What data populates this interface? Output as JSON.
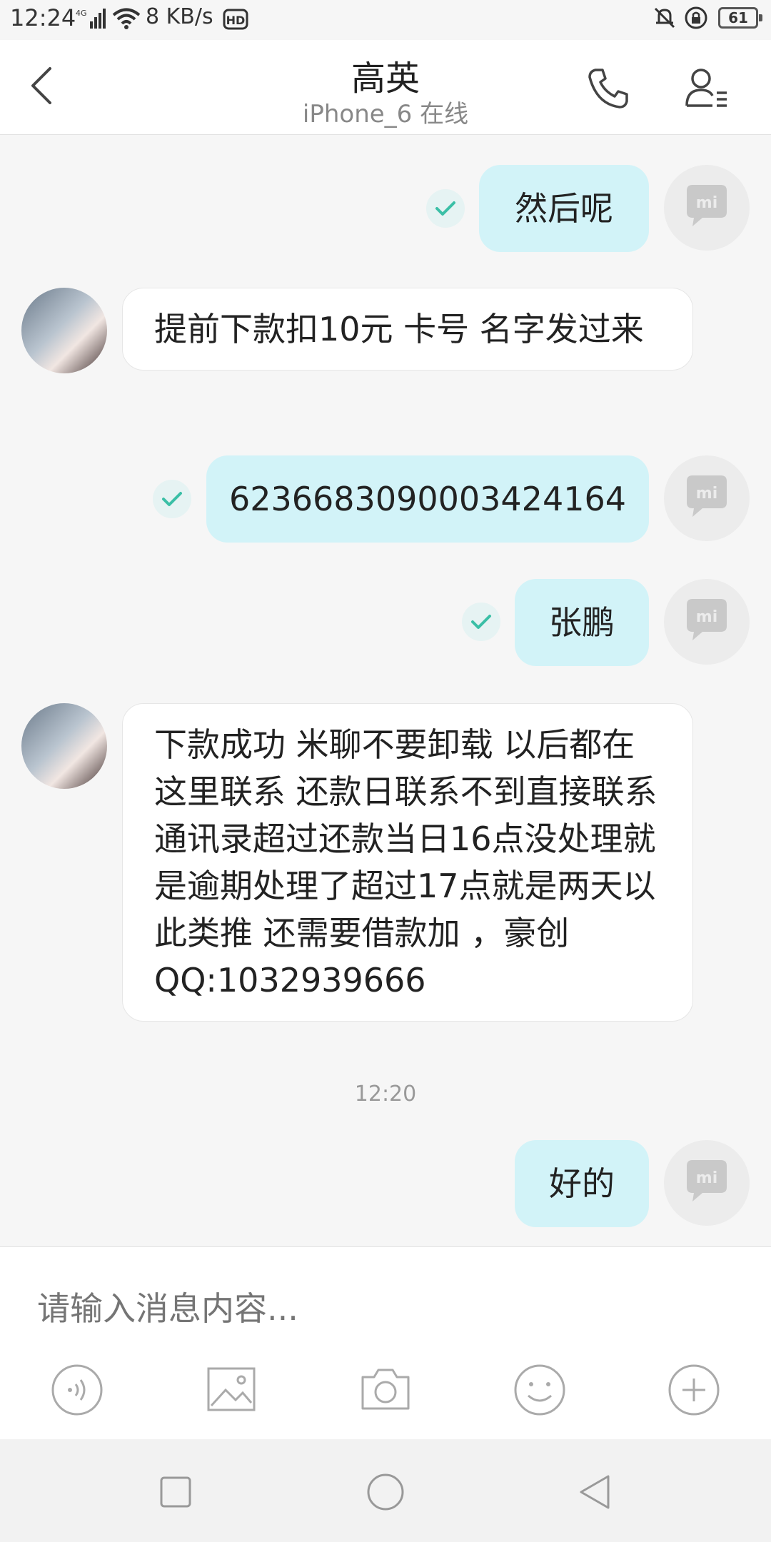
{
  "status_bar": {
    "time": "12:24",
    "network": "4G",
    "speed": "8 KB/s",
    "hd": "HD",
    "battery": "61",
    "icons": [
      "signal-icon",
      "wifi-icon",
      "hd-icon",
      "mute-icon",
      "lock-icon",
      "battery-icon"
    ]
  },
  "header": {
    "name": "高英",
    "status": "iPhone_6 在线"
  },
  "messages": [
    {
      "dir": "out",
      "text": "然后呢",
      "read": true
    },
    {
      "dir": "in",
      "text": "提前下款扣10元  卡号  名字发过来"
    },
    {
      "dir": "out",
      "text": "6236683090003424164",
      "read": true
    },
    {
      "dir": "out",
      "text": "张鹏",
      "read": true
    },
    {
      "dir": "in",
      "text": "下款成功  米聊不要卸载  以后都在这里联系  还款日联系不到直接联系通讯录超过还款当日16点没处理就是逾期处理了超过17点就是两天以此类推  还需要借款加 ，豪创QQ:1032939666"
    },
    {
      "dir": "out",
      "text": "好的"
    }
  ],
  "timestamp": "12:20",
  "composer": {
    "placeholder": "请输入消息内容...",
    "tools": [
      "voice-icon",
      "image-icon",
      "camera-icon",
      "emoji-icon",
      "plus-icon"
    ]
  },
  "colors": {
    "outgoing_bubble": "#d2f3f8",
    "incoming_bubble": "#ffffff",
    "check_mark": "#3bbfa6",
    "background": "#f6f6f6"
  }
}
